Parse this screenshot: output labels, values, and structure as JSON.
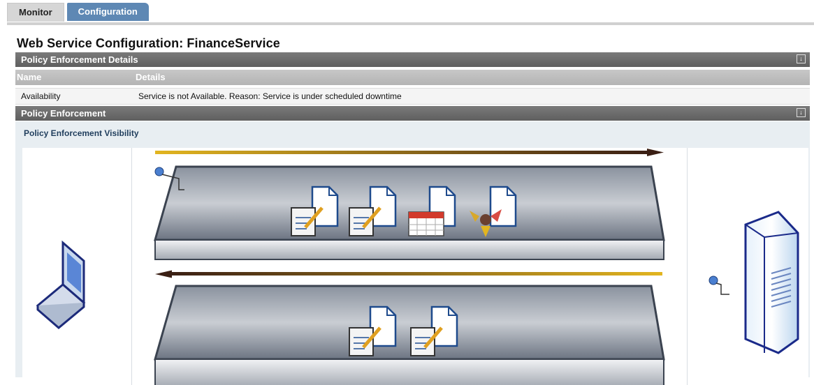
{
  "tabs": [
    {
      "label": "Monitor",
      "active": false
    },
    {
      "label": "Configuration",
      "active": true
    }
  ],
  "page_title": "Web Service Configuration: FinanceService",
  "policy_details": {
    "header": "Policy Enforcement Details",
    "columns": [
      "Name",
      "Details"
    ],
    "rows": [
      {
        "name": "Availability",
        "details": "Service is not Available. Reason: Service is under scheduled downtime"
      }
    ]
  },
  "policy_enforcement": {
    "header": "Policy Enforcement",
    "visibility_title": "Policy Enforcement Visibility"
  },
  "colors": {
    "tab_active": "#5e88b4",
    "section_header": "#6b6b6b",
    "arrow_gold": "#d9ad1c",
    "arrow_dark": "#4a2a1a",
    "platform_steel": "#6e7785"
  },
  "icons": {
    "request_policies": [
      "notepad-document-icon",
      "notepad-document-icon",
      "calendar-document-icon",
      "router-document-icon"
    ],
    "response_policies": [
      "notepad-document-icon",
      "notepad-document-icon"
    ]
  }
}
